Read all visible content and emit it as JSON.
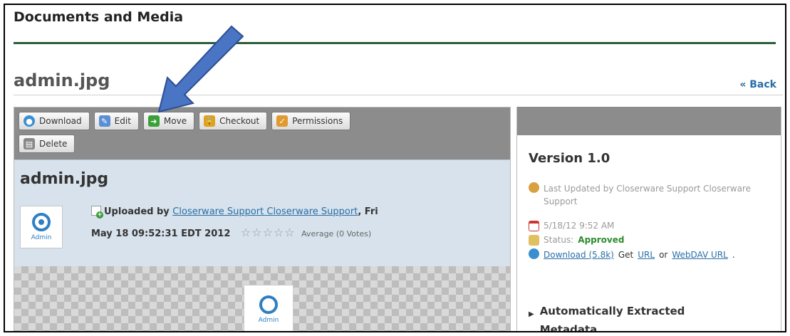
{
  "portlet": {
    "title": "Documents and Media"
  },
  "document": {
    "title": "admin.jpg",
    "back_label": "« Back"
  },
  "toolbar": {
    "buttons": [
      {
        "label": "Download",
        "icon": "globe-icon",
        "color": "#3a8fd1"
      },
      {
        "label": "Edit",
        "icon": "edit-icon",
        "color": "#5a8fd6"
      },
      {
        "label": "Move",
        "icon": "move-arrow-icon",
        "color": "#3aa03a"
      },
      {
        "label": "Checkout",
        "icon": "lock-icon",
        "color": "#e0a020"
      },
      {
        "label": "Permissions",
        "icon": "permissions-icon",
        "color": "#e09a30"
      },
      {
        "label": "Delete",
        "icon": "trash-icon",
        "color": "#888888"
      }
    ]
  },
  "info": {
    "file_name": "admin.jpg",
    "thumb_label": "Admin",
    "uploaded_by_label": "Uploaded by",
    "uploader": "Closerware Support Closerware Support",
    "date_first": ", Fri",
    "date_second": "May 18 09:52:31 EDT 2012",
    "stars": "☆☆☆☆☆",
    "average": "Average (0 Votes)"
  },
  "preview": {
    "thumb_label": "Admin"
  },
  "version": {
    "title": "Version 1.0",
    "last_updated": "Last Updated by Closerware Support Closerware Support",
    "date": "5/18/12 9:52 AM",
    "status_label": "Status:",
    "status_value": "Approved",
    "download_link": "Download (5.8k)",
    "get_label": "Get",
    "url_link": "URL",
    "or_label": "or",
    "webdav_link": "WebDAV URL",
    "period": ".",
    "metadata_heading": "Automatically Extracted Metadata"
  },
  "colors": {
    "accent_rule": "#2c5e3b",
    "link": "#2a6ea6",
    "approved": "#2e8b2e",
    "annotation_arrow": "#4a74c4"
  }
}
